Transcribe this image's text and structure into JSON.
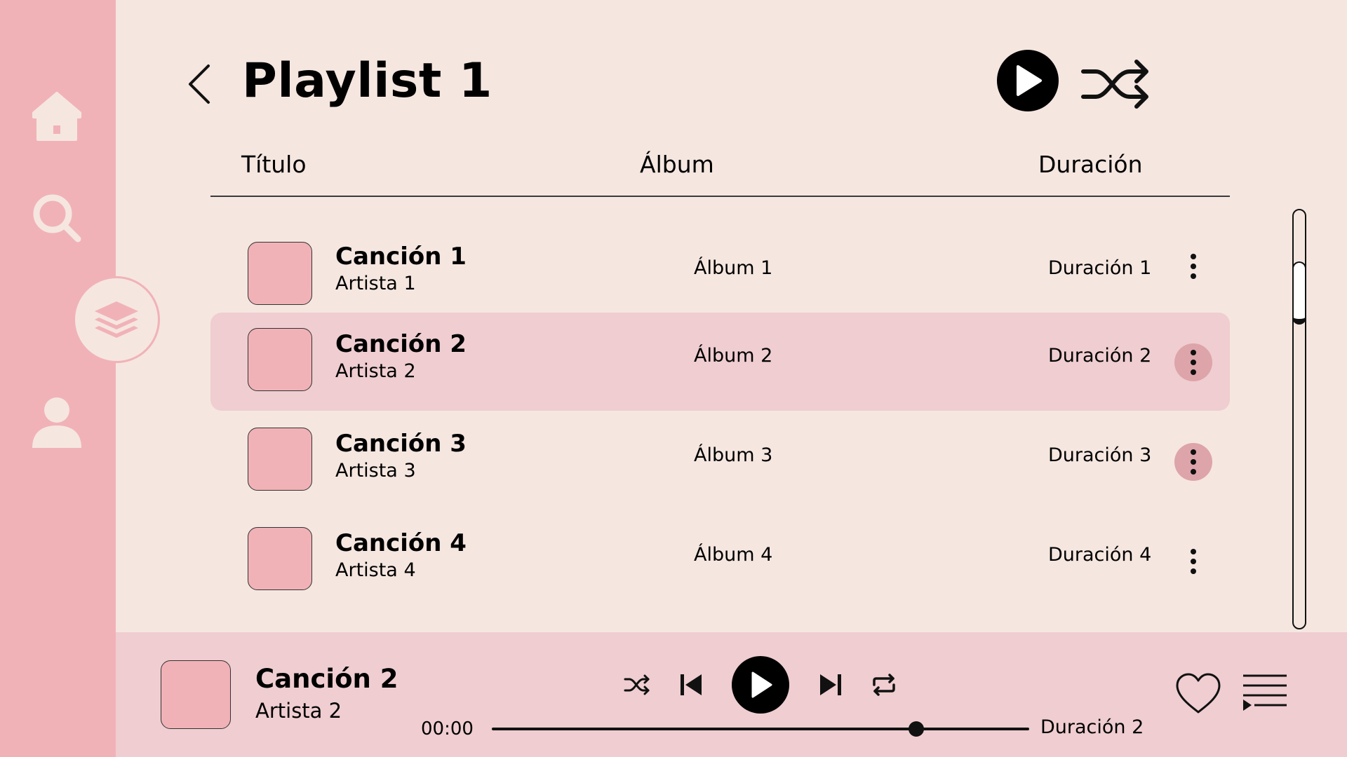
{
  "app": {
    "title": "Playlist 1",
    "accent_pink": "#F1B2B7",
    "background": "#F5E6E0",
    "selected_row_bg": "#EFCDD0"
  },
  "sidebar": {
    "items": [
      {
        "name": "home",
        "icon": "home-icon"
      },
      {
        "name": "search",
        "icon": "search-icon"
      },
      {
        "name": "library",
        "icon": "layers-icon",
        "active": true
      },
      {
        "name": "profile",
        "icon": "user-icon"
      }
    ]
  },
  "header": {
    "back_icon": "chevron-left-icon",
    "play_icon": "play-icon",
    "shuffle_icon": "shuffle-icon"
  },
  "table": {
    "columns": [
      "Título",
      "Álbum",
      "Duración"
    ],
    "rows": [
      {
        "title": "Canción 1",
        "artist": "Artista 1",
        "album": "Álbum 1",
        "duration": "Duración 1",
        "selected": false
      },
      {
        "title": "Canción 2",
        "artist": "Artista 2",
        "album": "Álbum 2",
        "duration": "Duración 2",
        "selected": true
      },
      {
        "title": "Canción 3",
        "artist": "Artista 3",
        "album": "Álbum 3",
        "duration": "Duración 3",
        "selected": false
      },
      {
        "title": "Canción 4",
        "artist": "Artista 4",
        "album": "Álbum 4",
        "duration": "Duración 4",
        "selected": false
      }
    ]
  },
  "player": {
    "title": "Canción 2",
    "artist": "Artista 2",
    "time_current": "00:00",
    "time_total": "Duración 2",
    "progress": 0.79
  }
}
